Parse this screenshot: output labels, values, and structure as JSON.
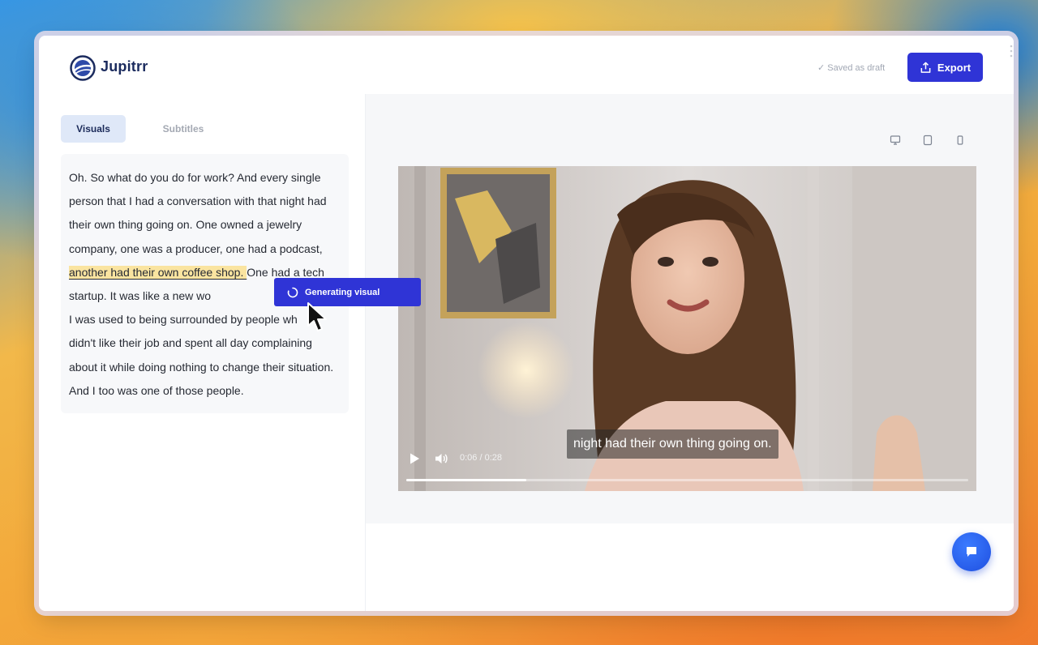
{
  "app": {
    "brand": "Jupitrr",
    "save_status": "✓ Saved as draft",
    "export_label": "Export"
  },
  "tabs": {
    "visuals": "Visuals",
    "subtitles": "Subtitles"
  },
  "transcript": {
    "before": "Oh. So what do you do for work? And every single person that I had a conversation with that night had their own thing going on. One owned a jewelry company, one was a producer, one had a podcast, ",
    "highlight": "another had their own coffee shop. ",
    "after": "One had a tech startup. It was like a new wo",
    "after2": "I was used to being surrounded by people wh",
    "after3": "didn't like their job and spent all day complaining about it while doing nothing to change their situation. And I too was one of those people."
  },
  "popup": {
    "label": "Generating visual"
  },
  "video": {
    "subtitle": "night had their own thing going on.",
    "time": "0:06 / 0:28",
    "progress": 0.214
  },
  "colors": {
    "accent": "#2f34d6",
    "highlight": "#fae4a0",
    "brand_text": "#1b2b5e"
  },
  "icons": {
    "logo": "jupitrr-logo-icon",
    "export": "upload-icon",
    "desktop": "desktop-icon",
    "tablet": "tablet-icon",
    "mobile": "mobile-icon",
    "play": "play-icon",
    "volume": "volume-icon",
    "spinner": "spinner-icon",
    "chat": "chat-icon",
    "cursor": "cursor-icon"
  }
}
